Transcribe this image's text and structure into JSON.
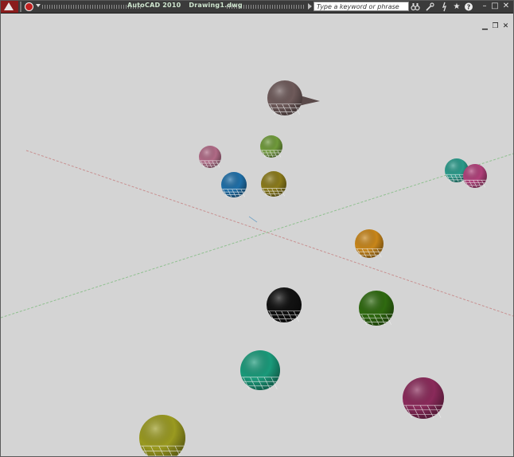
{
  "title": {
    "app_name": "AutoCAD 2010",
    "document_name": "Drawing1.dwg"
  },
  "search": {
    "placeholder": "Type a keyword or phrase"
  },
  "colors": {
    "title_bar": "#3b3b3b",
    "viewport_background": "#d4d4d4",
    "x_axis": "#c78a8a",
    "y_axis": "#8fbf8f"
  },
  "title_bar_icons": [
    "binoculars-icon",
    "subscription-center-icon",
    "communication-center-icon",
    "favorites-star-icon",
    "help-icon"
  ],
  "window_controls": [
    "minimize-icon",
    "restore-icon",
    "close-icon"
  ],
  "document_controls": [
    "minimize-icon",
    "restore-icon",
    "close-icon"
  ],
  "scene": {
    "spheres": [
      {
        "name": "sphere-gray-with-cone",
        "color": "#6e5a5a"
      },
      {
        "name": "sphere-pink-small",
        "color": "#b06a86"
      },
      {
        "name": "sphere-green-small",
        "color": "#6f9a3a"
      },
      {
        "name": "sphere-blue",
        "color": "#1f6fa8"
      },
      {
        "name": "sphere-olive",
        "color": "#8a7a1a"
      },
      {
        "name": "sphere-teal-right",
        "color": "#2a9a8a"
      },
      {
        "name": "sphere-magenta-right",
        "color": "#b0407a"
      },
      {
        "name": "sphere-orange",
        "color": "#c8861a"
      },
      {
        "name": "sphere-black",
        "color": "#111111"
      },
      {
        "name": "sphere-dark-green",
        "color": "#2f6a10"
      },
      {
        "name": "sphere-teal-large",
        "color": "#1a9a7a"
      },
      {
        "name": "sphere-plum",
        "color": "#8a2a5a"
      },
      {
        "name": "sphere-yellow-olive",
        "color": "#9a9a20"
      }
    ]
  }
}
